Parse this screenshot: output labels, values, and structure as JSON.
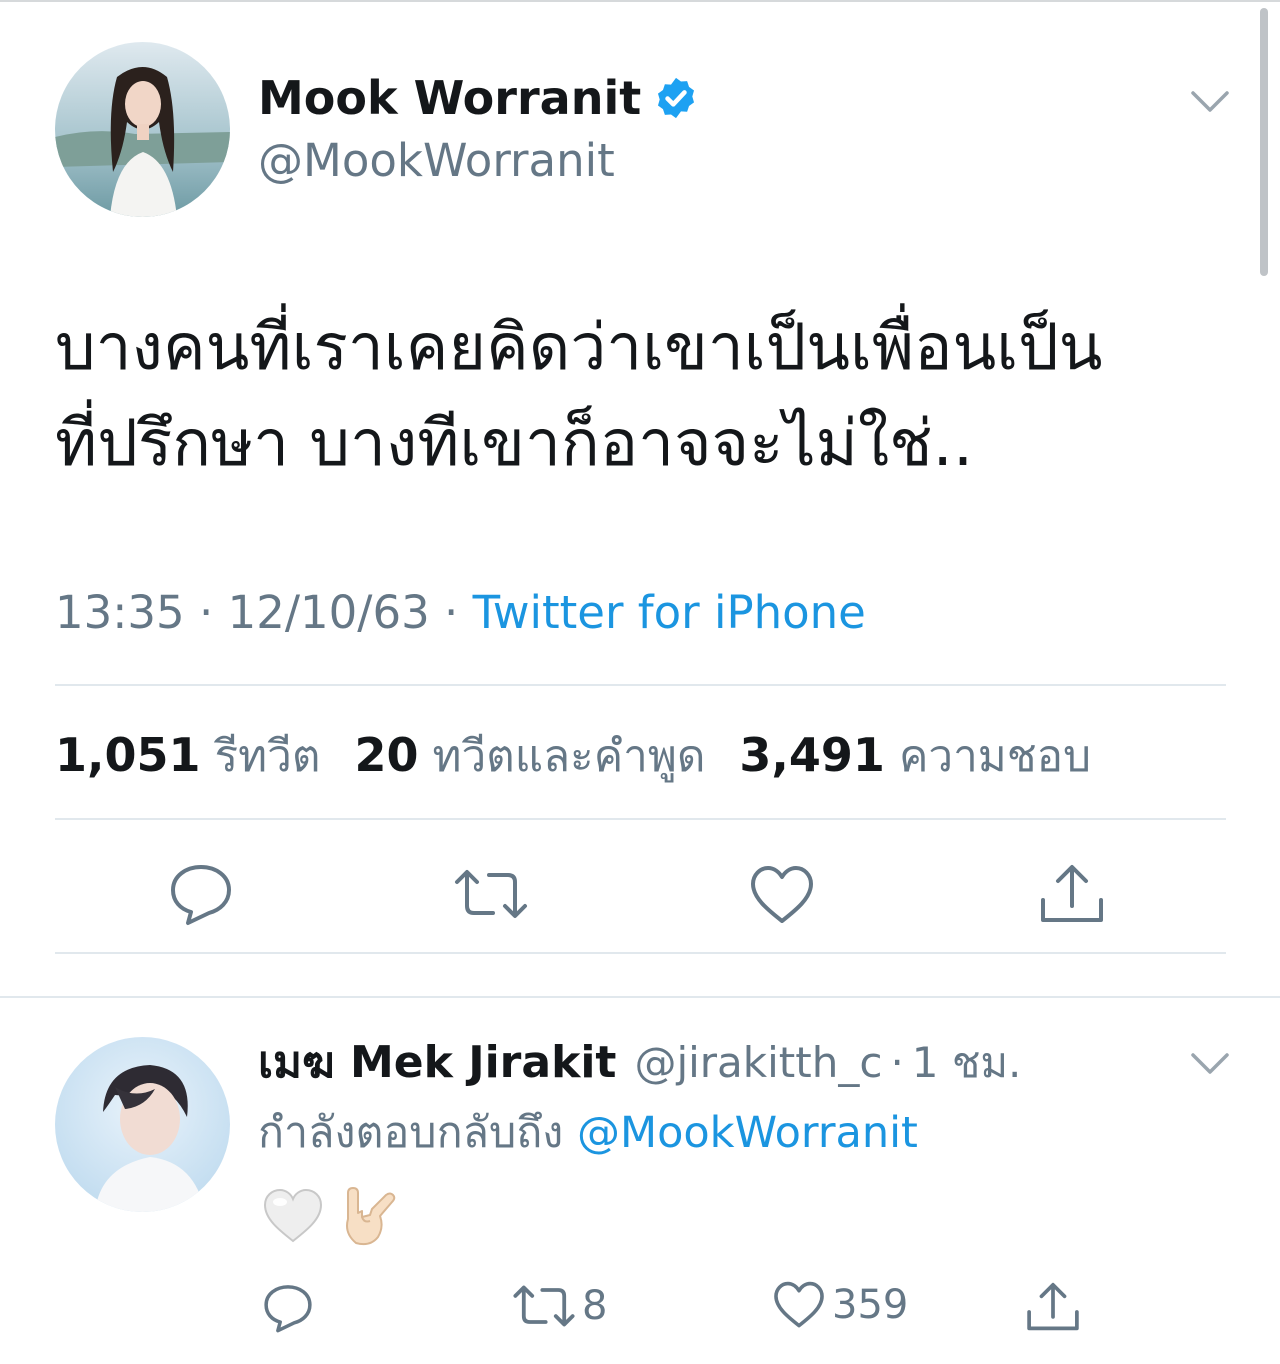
{
  "tweet": {
    "display_name": "Mook Worranit",
    "handle": "@MookWorranit",
    "verified": true,
    "text": "บางคนที่เราเคยคิดว่าเขาเป็นเพื่อนเป็น\nที่ปรึกษา บางทีเขาก็อาจจะไม่ใช่..",
    "time": "13:35",
    "date": "12/10/63",
    "meta_separator": "·",
    "source": "Twitter for iPhone",
    "stats": {
      "retweets_count": "1,051",
      "retweets_label": "รีทวีต",
      "quotes_count": "20",
      "quotes_label": "ทวีตและคำพูด",
      "likes_count": "3,491",
      "likes_label": "ความชอบ"
    },
    "actions": [
      "reply-icon",
      "retweet-icon",
      "like-icon",
      "share-icon"
    ]
  },
  "reply": {
    "display_name": "เมฆ Mek Jirakit",
    "handle": "@jirakitth_c",
    "separator": "·",
    "time_ago": "1 ชม.",
    "replying_to_label": "กำลังตอบกลับถึง",
    "replying_to_handle": "@MookWorranit",
    "emojis": [
      "white-heart",
      "love-you-gesture-light-skin"
    ],
    "retweet_count": "8",
    "like_count": "359",
    "actions": [
      "reply-icon",
      "retweet-icon",
      "like-icon",
      "share-icon"
    ]
  },
  "colors": {
    "text": "#14171a",
    "secondary": "#657786",
    "link": "#1b95e0",
    "verified": "#1da1f2",
    "divider": "#e1e8ed"
  }
}
